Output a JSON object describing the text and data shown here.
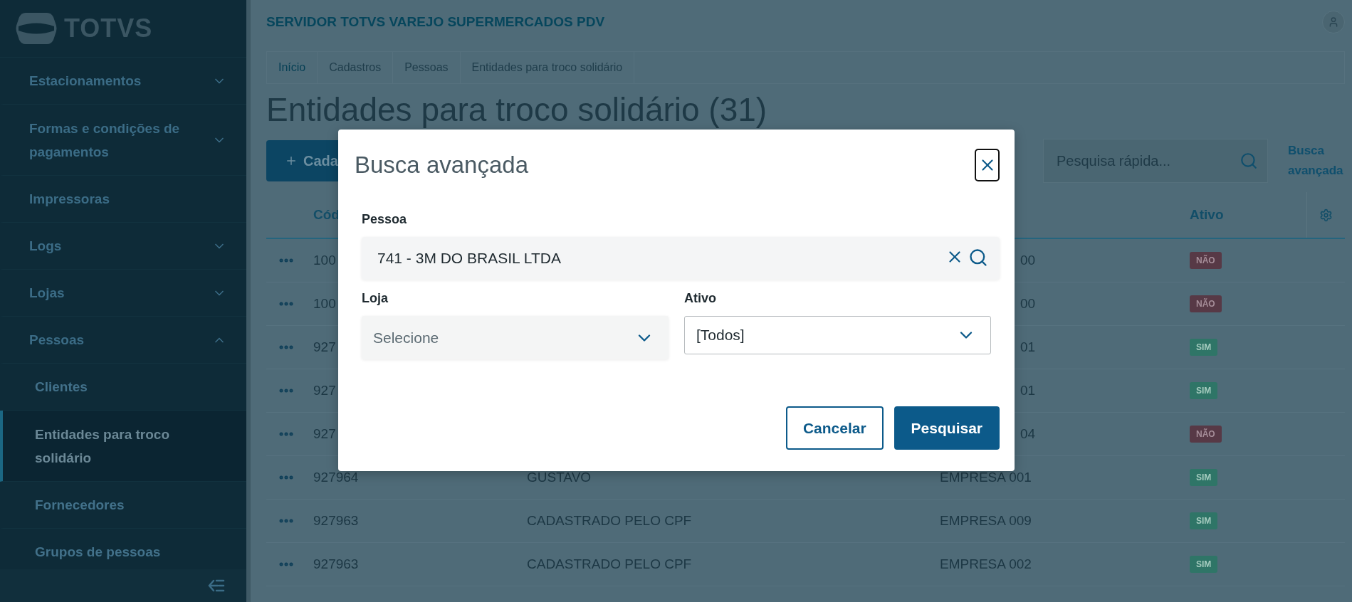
{
  "sidebar": {
    "logo_text": "TOTVS",
    "items": [
      {
        "kind": "group",
        "label": "Estacionamentos",
        "expanded": false
      },
      {
        "kind": "group",
        "label": "Formas e condições de pagamentos",
        "expanded": false
      },
      {
        "kind": "link",
        "label": "Impressoras"
      },
      {
        "kind": "group",
        "label": "Logs",
        "expanded": false
      },
      {
        "kind": "group",
        "label": "Lojas",
        "expanded": false
      },
      {
        "kind": "group",
        "label": "Pessoas",
        "expanded": true,
        "children": [
          {
            "label": "Clientes",
            "selected": false
          },
          {
            "label": "Entidades para troco solidário",
            "selected": true
          },
          {
            "label": "Fornecedores",
            "selected": false
          },
          {
            "label": "Grupos de pessoas",
            "selected": false
          }
        ]
      }
    ]
  },
  "header": {
    "title": "SERVIDOR TOTVS VAREJO SUPERMERCADOS PDV"
  },
  "breadcrumb": [
    {
      "label": "Início",
      "kind": "link"
    },
    {
      "label": "Cadastros",
      "kind": "text"
    },
    {
      "label": "Pessoas",
      "kind": "text"
    },
    {
      "label": "Entidades para troco solidário",
      "kind": "text"
    }
  ],
  "page": {
    "title": "Entidades para troco solidário (31)",
    "new_button": "Cada",
    "search_placeholder": "Pesquisa rápida...",
    "advanced_search_link": "Busca avançada"
  },
  "table": {
    "columns": [
      "Cód",
      "Ativo"
    ],
    "rows": [
      {
        "code": "100",
        "store": "00",
        "active_label": "NÃO",
        "active": false,
        "covered": true
      },
      {
        "code": "100",
        "store": "00",
        "active_label": "NÃO",
        "active": false,
        "covered": true
      },
      {
        "code": "927",
        "store": "01",
        "active_label": "SIM",
        "active": true,
        "covered": true
      },
      {
        "code": "927",
        "store": "01",
        "active_label": "SIM",
        "active": true,
        "covered": true
      },
      {
        "code": "927",
        "store": "04",
        "active_label": "NÃO",
        "active": false,
        "covered": true
      },
      {
        "code": "927964",
        "name": "GUSTAVO",
        "store": "EMPRESA 001",
        "active_label": "SIM",
        "active": true,
        "covered": false
      },
      {
        "code": "927963",
        "name": "CADASTRADO PELO CPF",
        "store": "EMPRESA 009",
        "active_label": "SIM",
        "active": true,
        "covered": false
      },
      {
        "code": "927963",
        "name": "CADASTRADO PELO CPF",
        "store": "EMPRESA 002",
        "active_label": "SIM",
        "active": true,
        "covered": false
      }
    ]
  },
  "modal": {
    "title": "Busca avançada",
    "person": {
      "label": "Pessoa",
      "value": "741 - 3M DO BRASIL LTDA"
    },
    "store": {
      "label": "Loja",
      "placeholder": "Selecione"
    },
    "active": {
      "label": "Ativo",
      "value": "[Todos]"
    },
    "buttons": [
      {
        "label": "Cancelar",
        "kind": "secondary"
      },
      {
        "label": "Pesquisar",
        "kind": "primary"
      }
    ]
  }
}
